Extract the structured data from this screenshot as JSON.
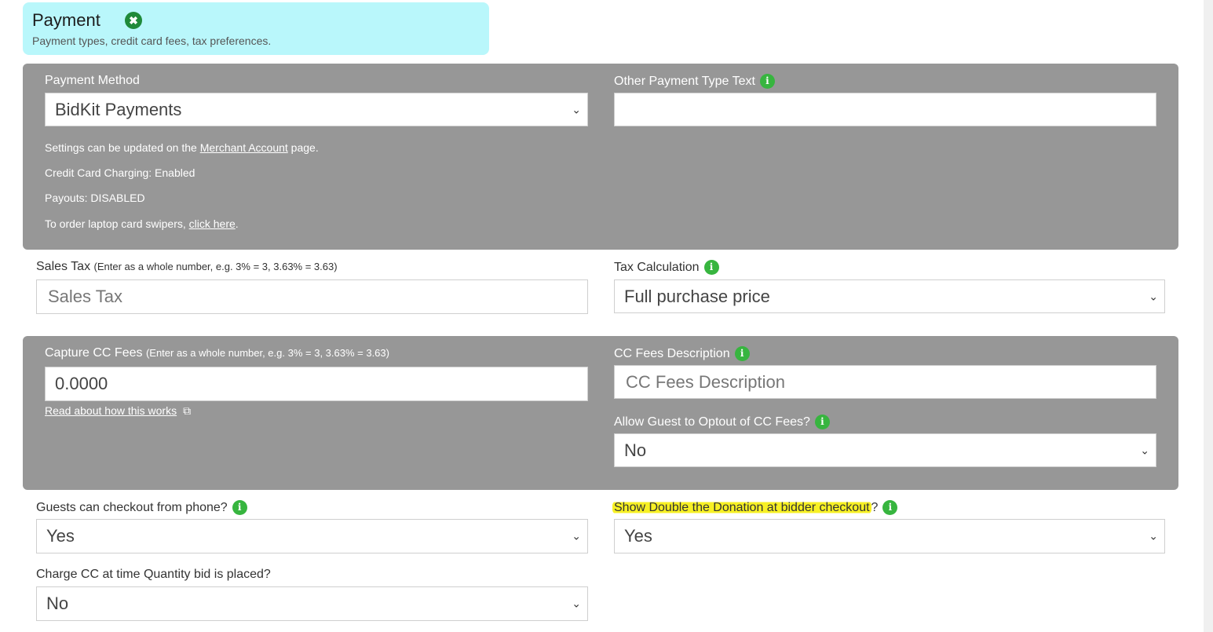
{
  "header": {
    "title": "Payment",
    "close_icon": "✖",
    "subtitle": "Payment types, credit card fees, tax preferences."
  },
  "payment_method": {
    "label": "Payment Method",
    "value": "BidKit Payments",
    "notes": {
      "settings_prefix": "Settings can be updated on the ",
      "merchant_link": "Merchant Account",
      "settings_suffix": " page.",
      "cc_charging": "Credit Card Charging: Enabled",
      "payouts": "Payouts: DISABLED",
      "swipers_prefix": "To order laptop card swipers, ",
      "swipers_link": "click here",
      "swipers_suffix": "."
    }
  },
  "other_payment": {
    "label": "Other Payment Type Text",
    "value": ""
  },
  "sales_tax": {
    "label": "Sales Tax",
    "hint": "(Enter as a whole number, e.g. 3% = 3, 3.63% = 3.63)",
    "placeholder": "Sales Tax"
  },
  "tax_calculation": {
    "label": "Tax Calculation",
    "value": "Full purchase price"
  },
  "cc_fees": {
    "label": "Capture CC Fees",
    "hint": "(Enter as a whole number, e.g. 3% = 3, 3.63% = 3.63)",
    "value": "0.0000",
    "link": "Read about how this works"
  },
  "cc_fees_description": {
    "label": "CC Fees Description",
    "placeholder": "CC Fees Description"
  },
  "optout": {
    "label": "Allow Guest to Optout of CC Fees?",
    "value": "No"
  },
  "phone_checkout": {
    "label": "Guests can checkout from phone?",
    "value": "Yes"
  },
  "double_donation": {
    "label": "Show Double the Donation at bidder checkout",
    "label_suffix": "?",
    "value": "Yes"
  },
  "charge_cc": {
    "label": "Charge CC at time Quantity bid is placed?",
    "value": "No"
  },
  "icons": {
    "info": "i",
    "chevron": "⌄",
    "external": "⧉"
  },
  "colors": {
    "header_bg": "#b9f7fb",
    "panel_bg": "#979797",
    "info_green": "#37b53f",
    "highlight": "#f7f024"
  }
}
